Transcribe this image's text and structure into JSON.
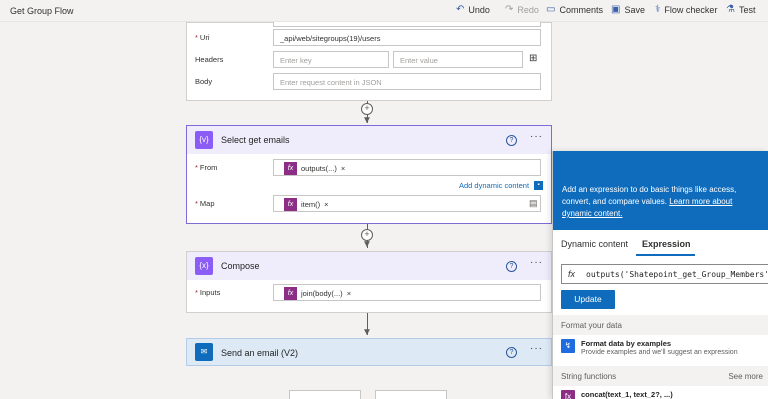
{
  "app_title": "Get Group Flow",
  "toolbar": {
    "undo": "Undo",
    "redo": "Redo",
    "comments": "Comments",
    "save": "Save",
    "flow_checker": "Flow checker",
    "test": "Test"
  },
  "http_card": {
    "uri_label": "Uri",
    "uri_value": "_api/web/sitegroups(19)/users",
    "headers_label": "Headers",
    "headers_key_placeholder": "Enter key",
    "headers_value_placeholder": "Enter value",
    "body_label": "Body",
    "body_placeholder": "Enter request content in JSON"
  },
  "select_card": {
    "title": "Select get emails",
    "icon_text": "{v}",
    "from_label": "From",
    "from_token": "outputs(...)",
    "add_dynamic_content": "Add dynamic content",
    "map_label": "Map",
    "map_token": "item()"
  },
  "compose_card": {
    "title": "Compose",
    "icon_text": "{x}",
    "inputs_label": "Inputs",
    "inputs_token": "join(body(...)"
  },
  "email_card": {
    "title": "Send an email (V2)"
  },
  "panel": {
    "banner_text": "Add an expression to do basic things like access, convert, and compare values.",
    "learn_more": "Learn more about dynamic content.",
    "tab_dynamic": "Dynamic content",
    "tab_expression": "Expression",
    "expression": "outputs('Shatepoint_get_Group_Members'",
    "update_button": "Update",
    "format_section": "Format your data",
    "format_item_title": "Format data by examples",
    "format_item_desc": "Provide examples and we'll suggest an expression",
    "string_section": "String functions",
    "see_more": "See more",
    "concat_item": "concat(text_1, text_2?, ...)"
  },
  "colors": {
    "accent": "#0f6cbd",
    "select_purple": "#8b5cf6",
    "fx_purple": "#8c2e86",
    "email_blue": "#0f6cbd"
  }
}
